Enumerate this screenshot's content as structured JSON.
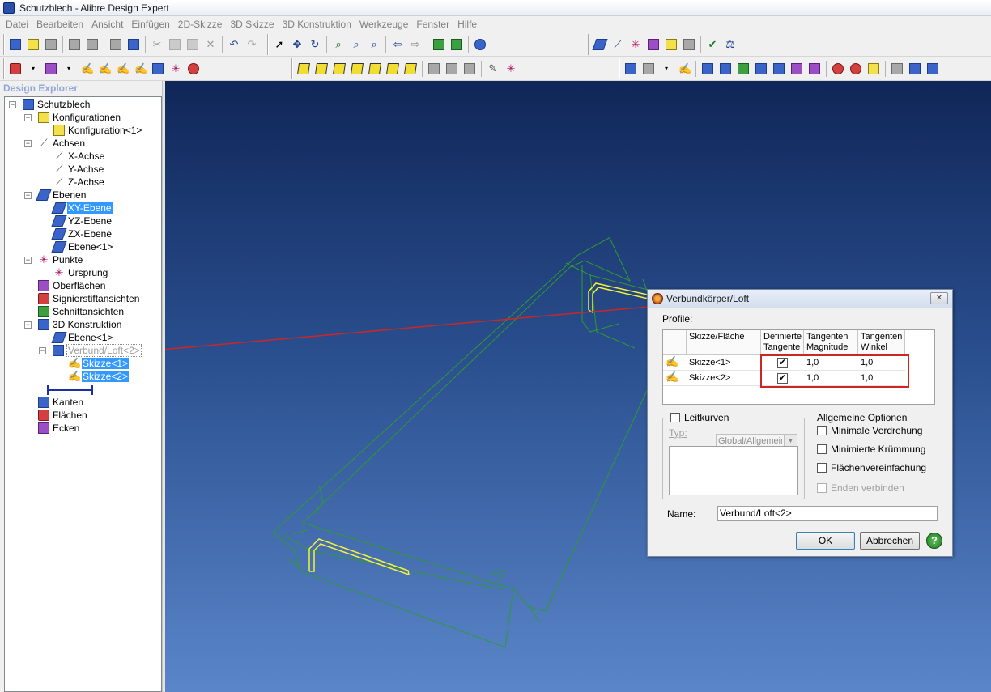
{
  "window": {
    "title": "Schutzblech - Alibre Design Expert"
  },
  "menu": [
    "Datei",
    "Bearbeiten",
    "Ansicht",
    "Einfügen",
    "2D-Skizze",
    "3D Skizze",
    "3D Konstruktion",
    "Werkzeuge",
    "Fenster",
    "Hilfe"
  ],
  "explorer": {
    "header": "Design Explorer",
    "items": [
      {
        "label": "Schutzblech",
        "icon": "part-icon"
      },
      {
        "label": "Konfigurationen",
        "icon": "configurations-icon"
      },
      {
        "label": "Konfiguration<1>",
        "icon": "configuration-icon"
      },
      {
        "label": "Achsen",
        "icon": "axes-icon"
      },
      {
        "label": "X-Achse",
        "icon": "axis-icon"
      },
      {
        "label": "Y-Achse",
        "icon": "axis-icon"
      },
      {
        "label": "Z-Achse",
        "icon": "axis-icon"
      },
      {
        "label": "Ebenen",
        "icon": "planes-icon"
      },
      {
        "label": "XY-Ebene",
        "icon": "plane-icon"
      },
      {
        "label": "YZ-Ebene",
        "icon": "plane-icon"
      },
      {
        "label": "ZX-Ebene",
        "icon": "plane-icon"
      },
      {
        "label": "Ebene<1>",
        "icon": "plane-icon"
      },
      {
        "label": "Punkte",
        "icon": "points-icon"
      },
      {
        "label": "Ursprung",
        "icon": "origin-icon"
      },
      {
        "label": "Oberflächen",
        "icon": "surfaces-icon"
      },
      {
        "label": "Signierstiftansichten",
        "icon": "markup-views-icon"
      },
      {
        "label": "Schnittansichten",
        "icon": "section-views-icon"
      },
      {
        "label": "3D Konstruktion",
        "icon": "3d-design-icon"
      },
      {
        "label": "Ebene<1>",
        "icon": "plane-icon"
      },
      {
        "label": "Verbund/Loft<2>",
        "icon": "loft-icon"
      },
      {
        "label": "Skizze<1>",
        "icon": "sketch-icon"
      },
      {
        "label": "Skizze<2>",
        "icon": "sketch-icon"
      },
      {
        "label": "Kanten",
        "icon": "edges-icon"
      },
      {
        "label": "Flächen",
        "icon": "faces-icon"
      },
      {
        "label": "Ecken",
        "icon": "vertices-icon"
      }
    ]
  },
  "dialog": {
    "title": "Verbundkörper/Loft",
    "close_label": "✕",
    "profile_label": "Profile:",
    "columns": [
      "Skizze/Fläche",
      "Definierte Tangente",
      "Tangenten Magnitude",
      "Tangenten Winkel"
    ],
    "rows": [
      {
        "sketch": "Skizze<1>",
        "tangent_defined": true,
        "check_glyph": "✔",
        "magnitude": "1,0",
        "angle": "1,0"
      },
      {
        "sketch": "Skizze<2>",
        "tangent_defined": true,
        "check_glyph": "✔",
        "magnitude": "1,0",
        "angle": "1,0"
      }
    ],
    "leitkurven": {
      "label": "Leitkurven",
      "checked": false,
      "type_label": "Typ:",
      "type_value": "Global/Allgemein",
      "type_arrow": "▼"
    },
    "general_options": {
      "title": "Allgemeine Optionen",
      "options": [
        {
          "label": "Minimale Verdrehung",
          "checked": false,
          "enabled": true
        },
        {
          "label": "Minimierte Krümmung",
          "checked": false,
          "enabled": true
        },
        {
          "label": "Flächenvereinfachung",
          "checked": false,
          "enabled": true
        },
        {
          "label": "Enden verbinden",
          "checked": false,
          "enabled": false
        }
      ]
    },
    "name_label": "Name:",
    "name_value": "Verbund/Loft<2>",
    "ok_label": "OK",
    "cancel_label": "Abbrechen",
    "help_label": "?"
  },
  "colors": {
    "selection": "#3399ff",
    "model_lines": "#2f9a2f",
    "sketch_highlight": "#f2f23a",
    "annotation_arrow": "#d02525",
    "viewport_top": "#102658",
    "viewport_bottom": "#5a86c9"
  }
}
